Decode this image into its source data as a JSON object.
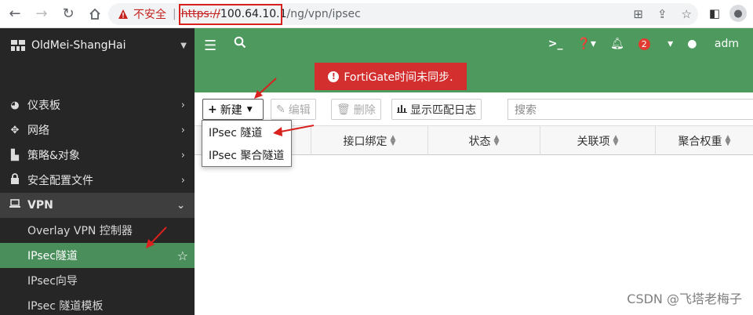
{
  "browser": {
    "insecure_label": "不安全",
    "separator": "|",
    "url_scheme": "https://",
    "url_host": "100.64.10.1",
    "url_path": "/ng/vpn/ipsec"
  },
  "sidebar": {
    "brand": "OldMei-ShangHai",
    "items": [
      {
        "label": "仪表板",
        "icon": "dashboard-icon"
      },
      {
        "label": "网络",
        "icon": "network-icon"
      },
      {
        "label": "策略&对象",
        "icon": "policy-icon"
      },
      {
        "label": "安全配置文件",
        "icon": "lock-icon"
      },
      {
        "label": "VPN",
        "icon": "laptop-icon"
      }
    ],
    "vpn_sub": [
      {
        "label": "Overlay VPN 控制器"
      },
      {
        "label": "IPsec隧道"
      },
      {
        "label": "IPsec向导"
      },
      {
        "label": "IPsec 隧道模板"
      }
    ]
  },
  "topbar": {
    "notification_count": "2",
    "user": "adm"
  },
  "alert": {
    "text": "FortiGate时间未同步."
  },
  "toolbar": {
    "new_label": "新建",
    "edit_label": "编辑",
    "delete_label": "删除",
    "log_label": "显示匹配日志",
    "search_placeholder": "搜索"
  },
  "table": {
    "columns": [
      "接口绑定",
      "状态",
      "关联项",
      "聚合权重"
    ]
  },
  "dropdown": {
    "items": [
      "IPsec 隧道",
      "IPsec 聚合隧道"
    ]
  },
  "watermark": "CSDN @飞塔老梅子",
  "colors": {
    "header_green": "#4e9a5e",
    "active_green": "#4a8f5b",
    "alert_red": "#d32f2f",
    "annotation_red": "#d9211e"
  }
}
